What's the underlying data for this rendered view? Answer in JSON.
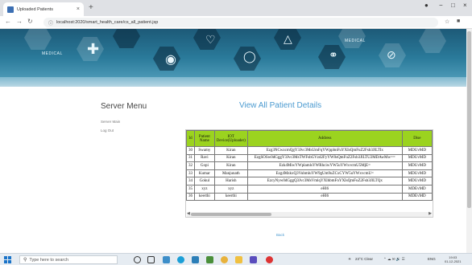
{
  "browser": {
    "tab_title": "Uploaded Patients",
    "tab_close": "×",
    "new_tab": "+",
    "url": "localhost:2020/smart_health_care/cs_all_patient.jsp",
    "window_controls": [
      "−",
      "□",
      "×"
    ]
  },
  "banner": {
    "medical_labels": [
      "MEDICAL",
      "MEDICAL"
    ]
  },
  "sidebar": {
    "title": "Server Menu",
    "links": [
      "Server Main",
      "Log Out"
    ]
  },
  "main": {
    "title": "View All Patient Details",
    "back_label": "Back"
  },
  "table": {
    "columns": [
      "Id",
      "Patient Name",
      "IOT Device(Uploader)",
      "Address",
      "Dise"
    ],
    "rows": [
      [
        "30",
        "Swamy",
        "Kiran",
        "Ezg3NCwzcmQgY3Jvc3MsUmFqYWppbnFuYXIsQmFuZ2Fsb3JlLTIx",
        "MDUvMD"
      ],
      [
        "31",
        "Ravi",
        "Kiran",
        "EzgSOSw0dGggY3Jvc3MsTWFsbGVzd2FyYW0sQmFuZ2Fsb3JlLTU2MDAwMw==",
        "MDUvMD"
      ],
      [
        "32",
        "Gopi",
        "Kiran",
        "Ezk4MiwYWplamlsYWRhciwYW5uYWxvcmU5MjE=",
        "MDUvMD"
      ],
      [
        "33",
        "Kumar",
        "Manjunath",
        "Ezg4MzkxQ3VubmluYW9gUm9uZCxCYW5uYWxvcmU=",
        "MDUvMD"
      ],
      [
        "34",
        "Gokul",
        "Harish",
        "EzcyNyw0dGggQ3Jvc3MsVmlqYXlhbmFnYXIsQmFuZ2Fsb3JlLTQx",
        "MDUvMD"
      ],
      [
        "35",
        "xyz",
        "xyz",
        "eHl6",
        "MDEvMD"
      ],
      [
        "36",
        "keerthi",
        "keerthi",
        "eHl6",
        "MDEvMD"
      ]
    ]
  },
  "taskbar": {
    "search_placeholder": "Type here to search",
    "weather": "23°C  Clear",
    "language": "ENG",
    "time": "19:03",
    "date": "01-12-2021"
  },
  "colors": {
    "table_header": "#9bd31f",
    "title_blue": "#4a9ad0",
    "banner": "#2a7a9a"
  }
}
